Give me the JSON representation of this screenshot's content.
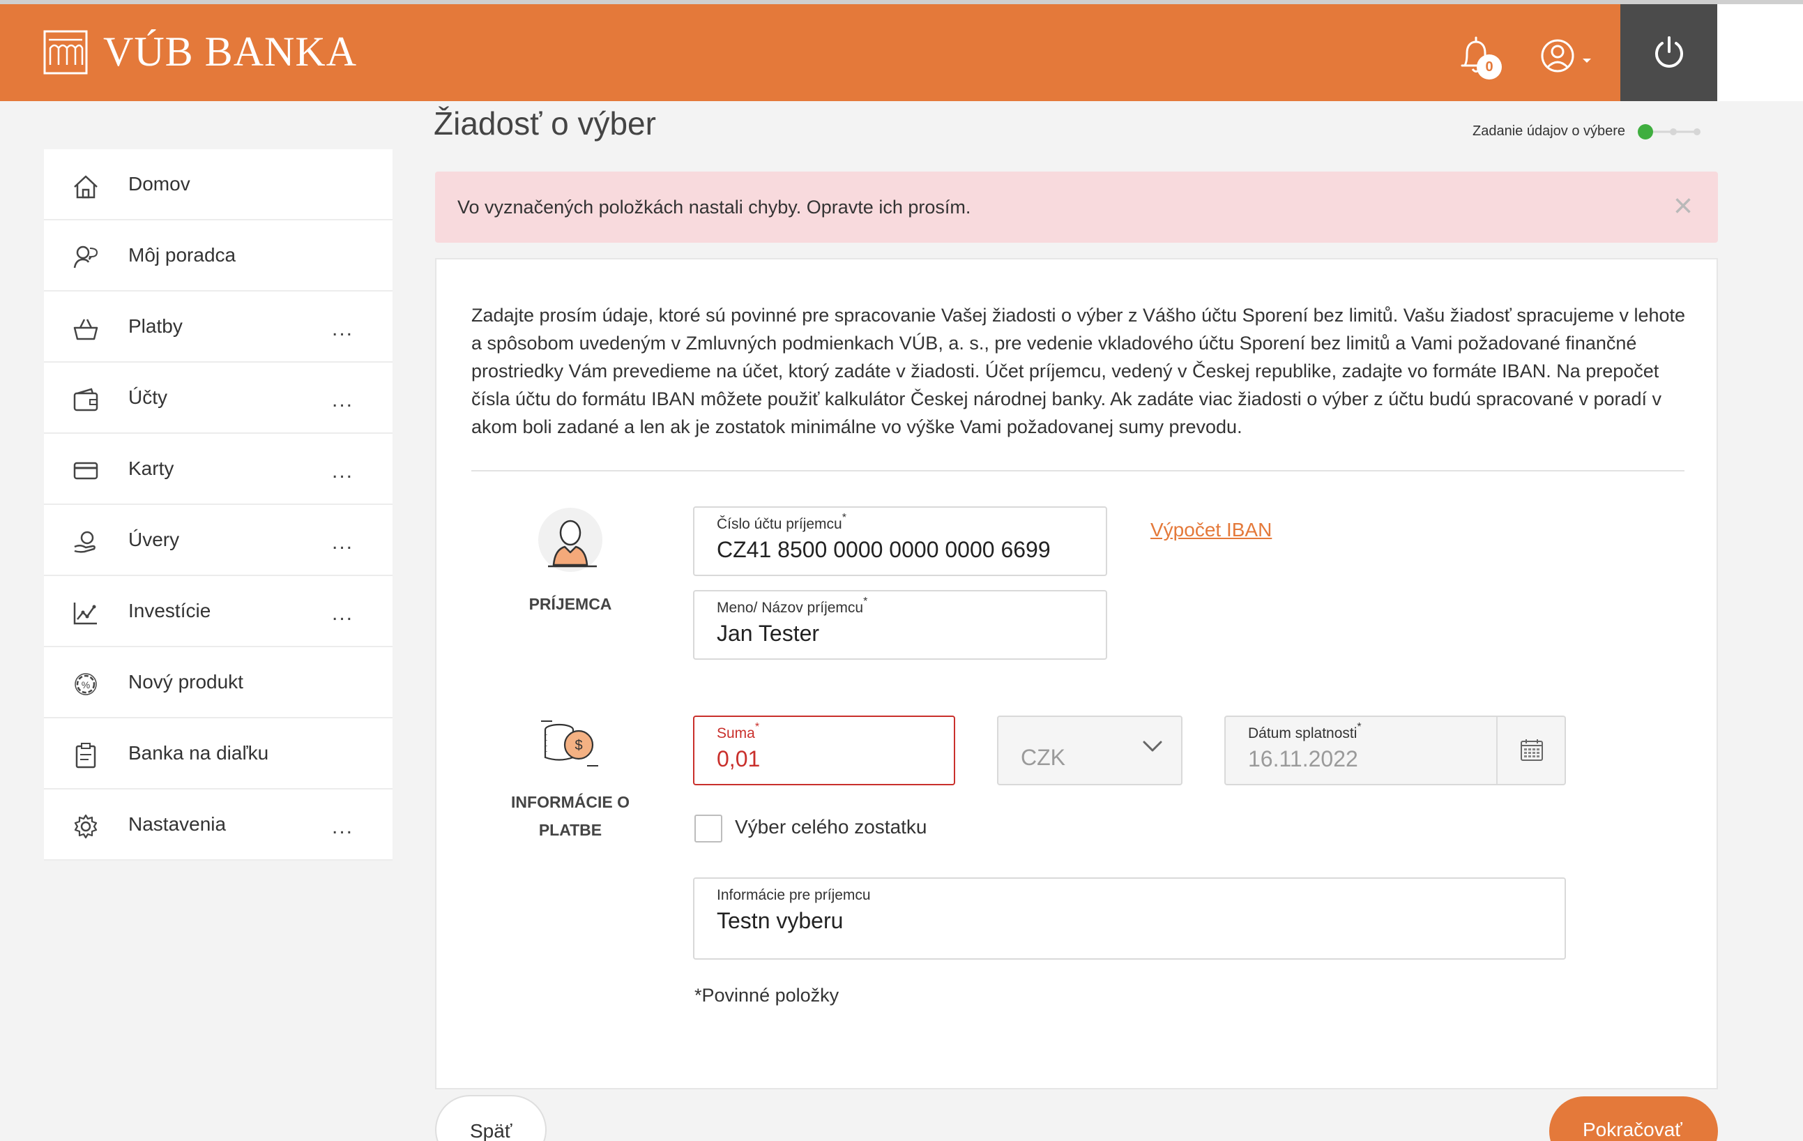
{
  "brand": {
    "name": "VÚB BANKA",
    "accent": "#e4793a"
  },
  "header": {
    "notifications_count": "0",
    "icons": [
      "bell-icon",
      "user-icon",
      "power-icon"
    ]
  },
  "sidebar": {
    "items": [
      {
        "label": "Domov",
        "icon": "home-icon",
        "has_more": false
      },
      {
        "label": "Môj poradca",
        "icon": "advisor-icon",
        "has_more": false
      },
      {
        "label": "Platby",
        "icon": "basket-icon",
        "has_more": true
      },
      {
        "label": "Účty",
        "icon": "wallet-icon",
        "has_more": true
      },
      {
        "label": "Karty",
        "icon": "card-icon",
        "has_more": true
      },
      {
        "label": "Úvery",
        "icon": "loan-icon",
        "has_more": true
      },
      {
        "label": "Investície",
        "icon": "chart-icon",
        "has_more": true
      },
      {
        "label": "Nový produkt",
        "icon": "percent-gear-icon",
        "has_more": false
      },
      {
        "label": "Banka na diaľku",
        "icon": "clipboard-icon",
        "has_more": false
      },
      {
        "label": "Nastavenia",
        "icon": "gear-icon",
        "has_more": true
      }
    ],
    "more_label": "..."
  },
  "main": {
    "title": "Žiadosť o výber",
    "step_label": "Zadanie údajov o výbere",
    "alert": {
      "text": "Vo vyznačených položkách nastali chyby. Opravte ich prosím.",
      "close": "×"
    },
    "intro": "Zadajte prosím údaje, ktoré sú povinné pre spracovanie Vašej žiadosti o výber z Vášho účtu Sporení bez limitů. Vašu žiadosť spracujeme v lehote a spôsobom uvedeným v Zmluvných podmienkach VÚB, a. s., pre vedenie vkladového účtu Sporení bez limitů a Vami požadované finančné prostriedky Vám prevedieme na účet, ktorý zadáte v žiadosti. Účet príjemcu, vedený v Českej republike, zadajte vo formáte IBAN. Na prepočet čísla účtu do formátu IBAN môžete použiť kalkulátor Českej národnej banky. Ak zadáte viac žiadosti o výber z účtu budú spracované v poradí v akom boli zadané a len ak je zostatok minimálne vo výške Vami požadovanej sumy prevodu.",
    "recipient": {
      "section_label": "PRÍJEMCA",
      "account_label": "Číslo účtu príjemcu",
      "account_value": "CZ41 8500 0000 0000 0000 6699",
      "name_label": "Meno/ Názov príjemcu",
      "name_value": "Jan Tester",
      "iban_link": "Výpočet IBAN"
    },
    "payment": {
      "section_label_line1": "INFORMÁCIE O",
      "section_label_line2": "PLATBE",
      "amount_label": "Suma",
      "amount_value": "0,01",
      "currency": "CZK",
      "due_date_label": "Dátum splatnosti",
      "due_date_value": "16.11.2022",
      "full_balance_label": "Výber celého zostatku",
      "full_balance_checked": false,
      "info_label": "Informácie pre príjemcu",
      "info_value": "Testn vyberu"
    },
    "required_marker": "*",
    "required_note": "*Povinné položky",
    "back_button": "Späť",
    "next_button": "Pokračovať"
  }
}
